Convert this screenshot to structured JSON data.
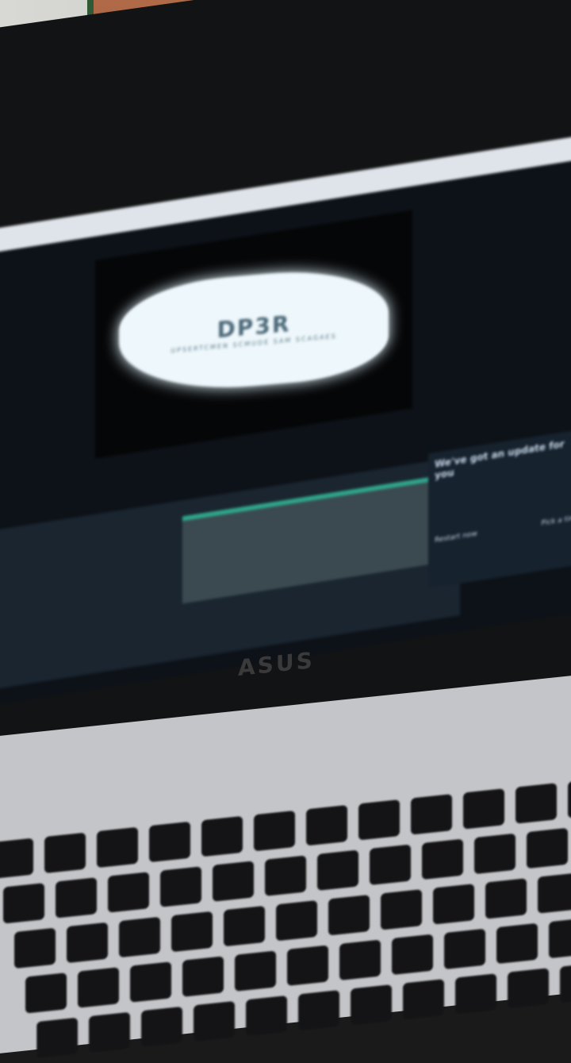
{
  "screen": {
    "video_title": "DP3R",
    "video_subtitle": "UPSERTCMEN SCMUDE SAM SCAGAES",
    "notification": {
      "title": "We've got an update for you",
      "restart_label": "Restart now",
      "pick_time_label": "Pick a time"
    },
    "accent_color": "#2fa58a"
  },
  "laptop": {
    "brand": "ASUS"
  }
}
